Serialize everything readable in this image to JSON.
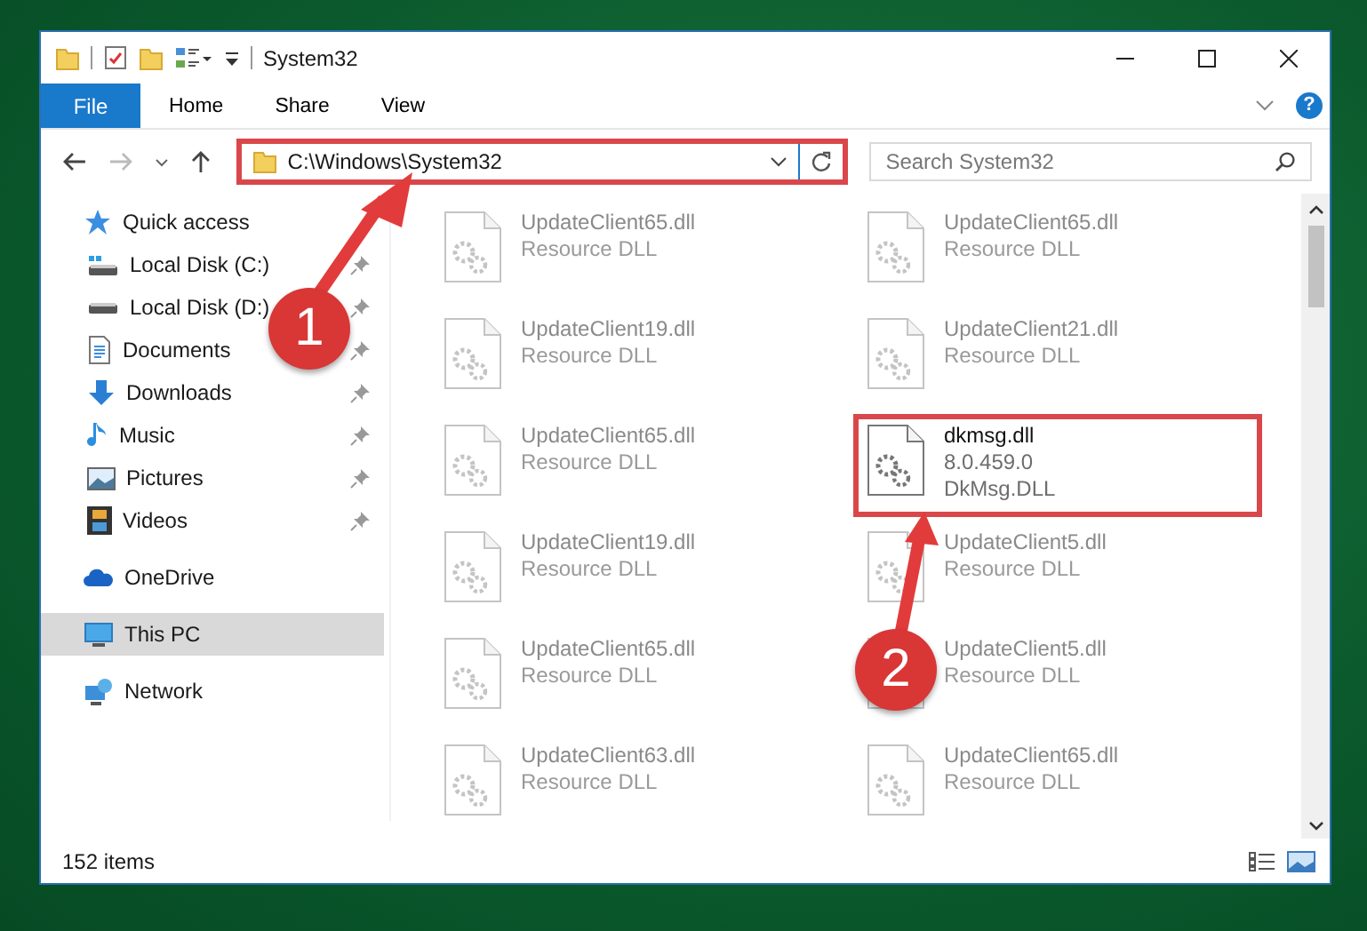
{
  "window": {
    "title": "System32"
  },
  "ribbon": {
    "tabs": [
      {
        "label": "File",
        "kind": "file"
      },
      {
        "label": "Home",
        "kind": "tab"
      },
      {
        "label": "Share",
        "kind": "tab"
      },
      {
        "label": "View",
        "kind": "tab"
      }
    ],
    "help": "?"
  },
  "address": {
    "path": "C:\\Windows\\System32",
    "highlighted": true
  },
  "search": {
    "placeholder": "Search System32"
  },
  "sidebar": [
    {
      "label": "Quick access",
      "kind": "star",
      "selected": false,
      "children": [
        {
          "label": "Local Disk (C:)",
          "kind": "disk-win",
          "pinned": true
        },
        {
          "label": "Local Disk (D:)",
          "kind": "disk",
          "pinned": true
        },
        {
          "label": "Documents",
          "kind": "doc",
          "pinned": true
        },
        {
          "label": "Downloads",
          "kind": "download",
          "pinned": true
        },
        {
          "label": "Music",
          "kind": "music",
          "pinned": true
        },
        {
          "label": "Pictures",
          "kind": "pictures",
          "pinned": true
        },
        {
          "label": "Videos",
          "kind": "videos",
          "pinned": true
        }
      ]
    },
    {
      "label": "OneDrive",
      "kind": "cloud",
      "selected": false
    },
    {
      "label": "This PC",
      "kind": "pc",
      "selected": true
    },
    {
      "label": "Network",
      "kind": "network",
      "selected": false
    }
  ],
  "files": [
    {
      "name": "UpdateClient65.dll",
      "details": [
        "Resource DLL"
      ],
      "highlighted": false
    },
    {
      "name": "UpdateClient65.dll",
      "details": [
        "Resource DLL"
      ],
      "highlighted": false
    },
    {
      "name": "UpdateClient19.dll",
      "details": [
        "Resource DLL"
      ],
      "highlighted": false
    },
    {
      "name": "UpdateClient21.dll",
      "details": [
        "Resource DLL"
      ],
      "highlighted": false
    },
    {
      "name": "UpdateClient65.dll",
      "details": [
        "Resource DLL"
      ],
      "highlighted": false
    },
    {
      "name": "dkmsg.dll",
      "details": [
        "8.0.459.0",
        "DkMsg.DLL"
      ],
      "highlighted": true
    },
    {
      "name": "UpdateClient19.dll",
      "details": [
        "Resource DLL"
      ],
      "highlighted": false
    },
    {
      "name": "UpdateClient5.dll",
      "details": [
        "Resource DLL"
      ],
      "highlighted": false
    },
    {
      "name": "UpdateClient65.dll",
      "details": [
        "Resource DLL"
      ],
      "highlighted": false
    },
    {
      "name": "UpdateClient5.dll",
      "details": [
        "Resource DLL"
      ],
      "highlighted": false
    },
    {
      "name": "UpdateClient63.dll",
      "details": [
        "Resource DLL"
      ],
      "highlighted": false
    },
    {
      "name": "UpdateClient65.dll",
      "details": [
        "Resource DLL"
      ],
      "highlighted": false
    }
  ],
  "annotations": [
    {
      "number": "1"
    },
    {
      "number": "2"
    }
  ],
  "status_bar": {
    "item_count": "152 items"
  }
}
